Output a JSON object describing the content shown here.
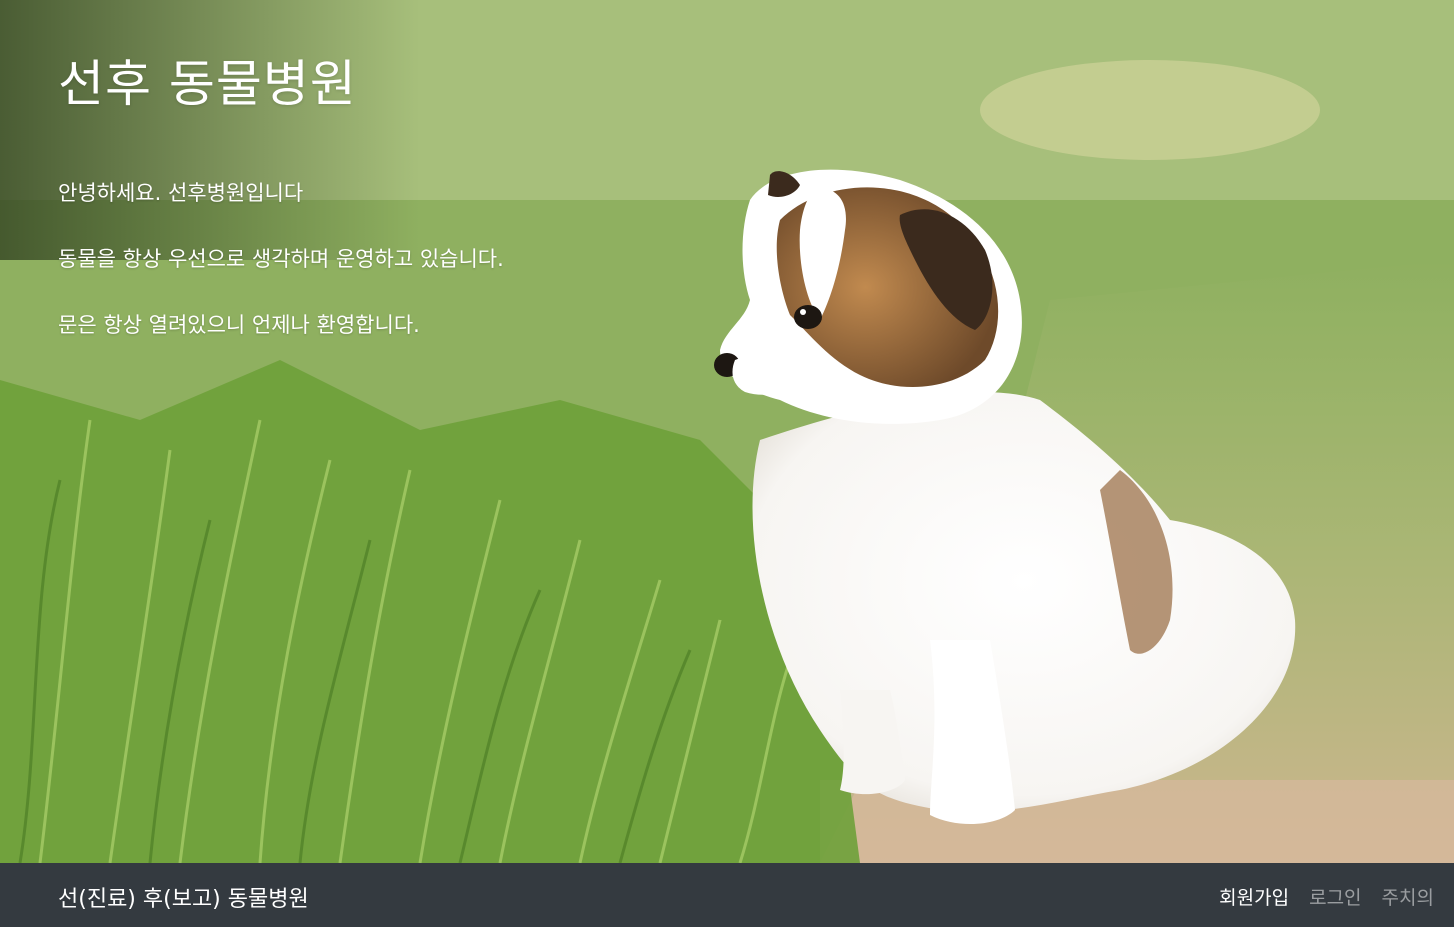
{
  "hero": {
    "title": "선후 동물병원",
    "intro": [
      "안녕하세요. 선후병원입니다",
      "동물을 항상 우선으로 생각하며 운영하고 있습니다.",
      "문은 항상 열려있으니 언제나 환영합니다."
    ],
    "image_subject": "puppy-in-grass"
  },
  "navbar": {
    "brand": "선(진료) 후(보고) 동물병원",
    "links": [
      "회원가입",
      "로그인",
      "주치의"
    ],
    "background_color": "#343a40"
  }
}
